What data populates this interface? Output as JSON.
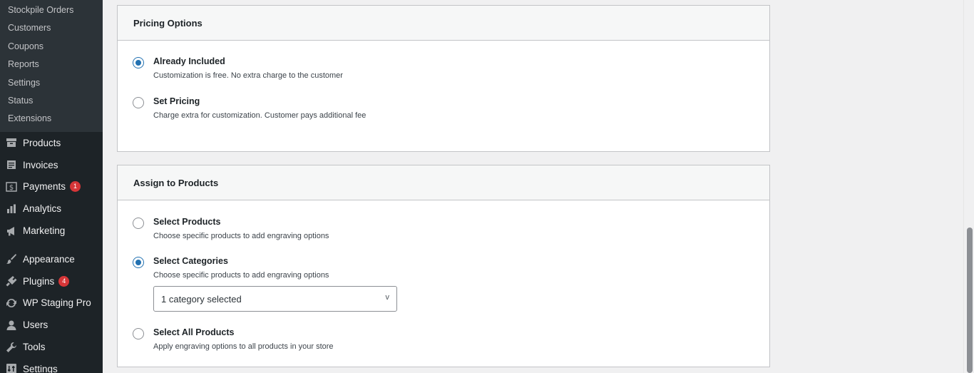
{
  "sidebar": {
    "submenu": [
      "Stockpile Orders",
      "Customers",
      "Coupons",
      "Reports",
      "Settings",
      "Status",
      "Extensions"
    ],
    "menu": [
      {
        "label": "Products",
        "icon": "archive-icon"
      },
      {
        "label": "Invoices",
        "icon": "invoice-icon"
      },
      {
        "label": "Payments",
        "icon": "dollar-icon",
        "badge": "1"
      },
      {
        "label": "Analytics",
        "icon": "bar-chart-icon"
      },
      {
        "label": "Marketing",
        "icon": "megaphone-icon"
      },
      {
        "label": "Appearance",
        "icon": "paintbrush-icon"
      },
      {
        "label": "Plugins",
        "icon": "plug-icon",
        "badge": "4"
      },
      {
        "label": "WP Staging Pro",
        "icon": "sync-icon"
      },
      {
        "label": "Users",
        "icon": "user-icon"
      },
      {
        "label": "Tools",
        "icon": "wrench-icon"
      },
      {
        "label": "Settings",
        "icon": "settings-icon"
      }
    ]
  },
  "pricing": {
    "title": "Pricing Options",
    "options": [
      {
        "label": "Already Included",
        "desc": "Customization is free. No extra charge to the customer",
        "checked": true
      },
      {
        "label": "Set Pricing",
        "desc": "Charge extra for customization. Customer pays additional fee",
        "checked": false
      }
    ]
  },
  "assign": {
    "title": "Assign to Products",
    "options": [
      {
        "label": "Select Products",
        "desc": "Choose specific products to add engraving options",
        "checked": false
      },
      {
        "label": "Select Categories",
        "desc": "Choose specific products to add engraving options",
        "checked": true
      },
      {
        "label": "Select All Products",
        "desc": "Apply engraving options to all products in your store",
        "checked": false
      }
    ],
    "category_select": {
      "value": "1 category selected",
      "chevron": "v"
    }
  },
  "colors": {
    "sidebar_bg": "#1d2327",
    "submenu_bg": "#2c3338",
    "accent": "#2271b1",
    "badge": "#d63638"
  }
}
